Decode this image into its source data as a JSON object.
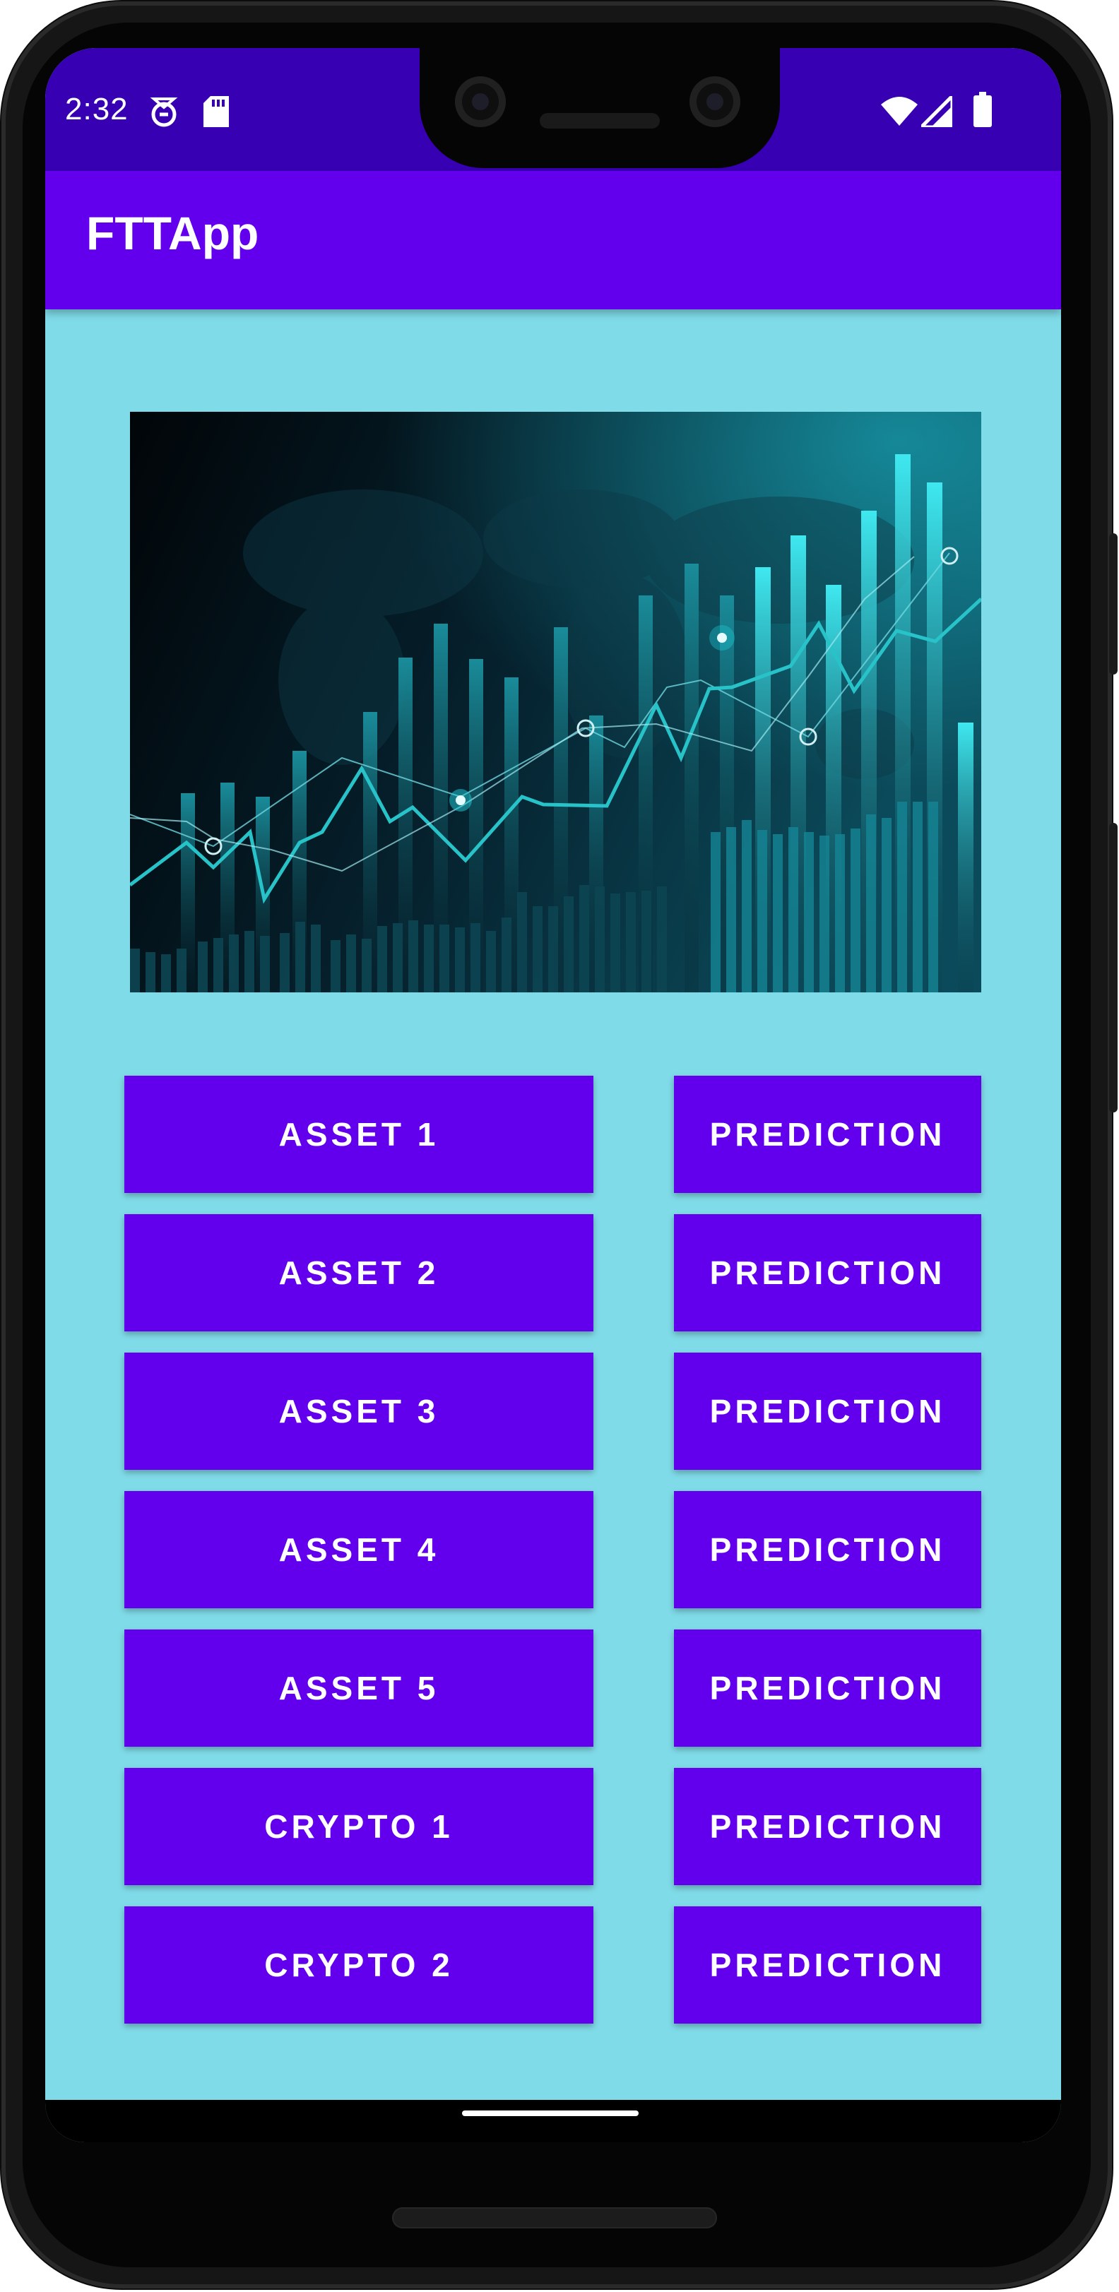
{
  "status_bar": {
    "time": "2:32",
    "icons": [
      "do-not-disturb-icon",
      "sd-card-icon",
      "wifi-icon",
      "signal-icon",
      "battery-icon"
    ]
  },
  "app_bar": {
    "title": "FTTApp"
  },
  "colors": {
    "status_bar": "#3700b3",
    "app_bar": "#6200ee",
    "background": "#7fdbe8",
    "button": "#6200ee",
    "button_text": "#ffffff"
  },
  "rows": [
    {
      "asset": "ASSET 1",
      "prediction": "PREDICTION"
    },
    {
      "asset": "ASSET 2",
      "prediction": "PREDICTION"
    },
    {
      "asset": "ASSET 3",
      "prediction": "PREDICTION"
    },
    {
      "asset": "ASSET 4",
      "prediction": "PREDICTION"
    },
    {
      "asset": "ASSET 5",
      "prediction": "PREDICTION"
    },
    {
      "asset": "CRYPTO 1",
      "prediction": "PREDICTION"
    },
    {
      "asset": "CRYPTO 2",
      "prediction": "PREDICTION"
    }
  ]
}
